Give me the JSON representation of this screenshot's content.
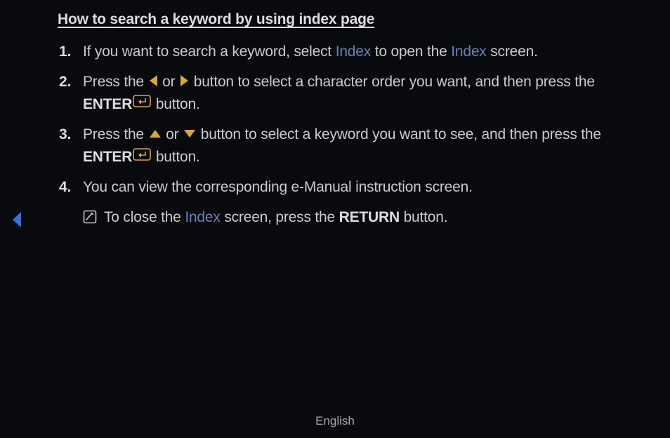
{
  "title": "How to search a keyword by using index page",
  "steps": {
    "s1_a": "If you want to search a keyword, select ",
    "s1_b": "Index",
    "s1_c": " to open the ",
    "s1_d": "Index",
    "s1_e": " screen.",
    "s2_a": "Press the ",
    "s2_b": " or ",
    "s2_c": " button to select a character order you want, and then press the ",
    "s2_d": "ENTER",
    "s2_e": " button.",
    "s3_a": "Press the ",
    "s3_b": " or ",
    "s3_c": " button to select a keyword you want to see, and then press the ",
    "s3_d": "ENTER",
    "s3_e": " button.",
    "s4": "You can view the corresponding e-Manual instruction screen."
  },
  "note": {
    "a": "To close the ",
    "b": "Index",
    "c": " screen, press the ",
    "d": "RETURN",
    "e": " button."
  },
  "footer": "English"
}
